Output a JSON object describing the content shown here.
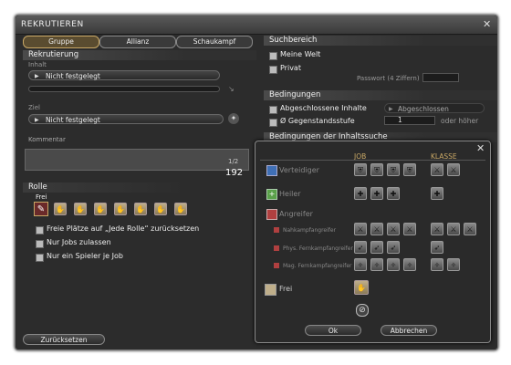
{
  "window": {
    "title": "REKRUTIEREN"
  },
  "tabs": [
    "Gruppe",
    "Allianz",
    "Schaukampf"
  ],
  "left": {
    "recruit_title": "Rekrutierung",
    "content_label": "Inhalt",
    "content_value": "Nicht festgelegt",
    "goal_label": "Ziel",
    "goal_value": "Nicht festgelegt",
    "comment_label": "Kommentar",
    "comment_page": "1/2",
    "comment_count": "192",
    "role_title": "Rolle",
    "free_label": "Frei",
    "options": [
      "Freie Plätze auf „Jede Rolle“ zurücksetzen",
      "Nur Jobs zulassen",
      "Nur ein Spieler je Job"
    ],
    "reset_button": "Zurücksetzen"
  },
  "right": {
    "search_title": "Suchbereich",
    "search_options": [
      "Meine Welt",
      "Privat"
    ],
    "password_placeholder": "Passwort (4 Ziffern)",
    "conditions_title": "Bedingungen",
    "completed_label": "Abgeschlossene Inhalte",
    "completed_value": "Abgeschlossen",
    "item_level_label": "Ø Gegenstandsstufe",
    "item_level_value": "1",
    "or_higher": "oder höher",
    "search_conditions_title": "Bedingungen der Inhaltssuche"
  },
  "popup": {
    "col_job": "JOB",
    "col_class": "KLASSE",
    "roles": {
      "tank": "Verteidiger",
      "healer": "Heiler",
      "dps": "Angreifer",
      "melee": "Nahkampfangreifer",
      "ranged_phys": "Phys. Fernkampfangreifer",
      "ranged_mag": "Mag. Fernkampfangreifer",
      "free": "Frei"
    },
    "ok_button": "Ok",
    "cancel_button": "Abbrechen"
  },
  "colors": {
    "window_bg": "#2c2c2c",
    "accent_gold": "#c9a866",
    "tank_blue": "#3f6fb5",
    "healer_green": "#5aa04a",
    "dps_red": "#b04040"
  }
}
